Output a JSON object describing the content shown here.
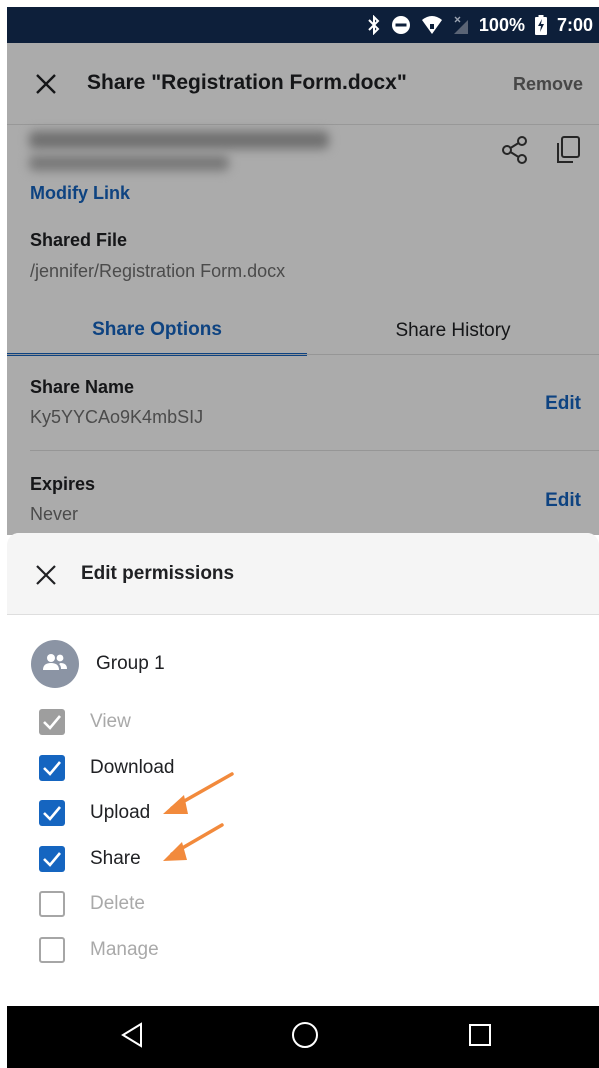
{
  "status_bar": {
    "battery": "100%",
    "time": "7:00",
    "icons": [
      "bluetooth-icon",
      "do-not-disturb-icon",
      "wifi-icon",
      "no-signal-icon",
      "battery-charging-icon"
    ]
  },
  "app_bar": {
    "title": "Share \"Registration Form.docx\"",
    "remove_label": "Remove"
  },
  "link": {
    "modify_label": "Modify Link",
    "icons": [
      "share-icon",
      "copy-icon"
    ]
  },
  "shared_file": {
    "label": "Shared File",
    "path": "/jennifer/Registration Form.docx"
  },
  "tabs": [
    {
      "label": "Share Options",
      "active": true
    },
    {
      "label": "Share History",
      "active": false
    }
  ],
  "options": [
    {
      "label": "Share Name",
      "value": "Ky5YYCAo9K4mbSIJ",
      "action": "Edit"
    },
    {
      "label": "Expires",
      "value": "Never",
      "action": "Edit"
    }
  ],
  "sheet": {
    "title": "Edit permissions",
    "group_name": "Group 1",
    "permissions": [
      {
        "label": "View",
        "checked": true,
        "enabled": false
      },
      {
        "label": "Download",
        "checked": true,
        "enabled": true
      },
      {
        "label": "Upload",
        "checked": true,
        "enabled": true
      },
      {
        "label": "Share",
        "checked": true,
        "enabled": true
      },
      {
        "label": "Delete",
        "checked": false,
        "enabled": false
      },
      {
        "label": "Manage",
        "checked": false,
        "enabled": false
      }
    ]
  },
  "colors": {
    "accent": "#1565c0",
    "annotation_arrow": "#f28a3c",
    "status_bar": "#0d1f3a"
  }
}
